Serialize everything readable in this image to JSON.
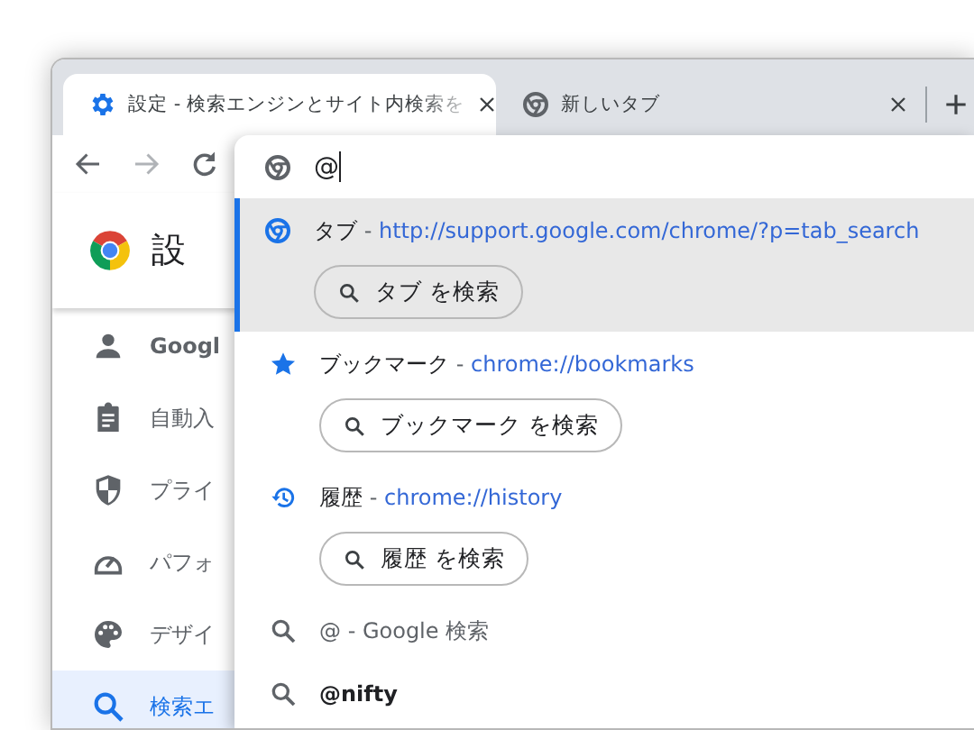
{
  "tabs": [
    {
      "title": "設定 - 検索エンジンとサイト内検索を",
      "kind": "settings",
      "selected": true
    },
    {
      "title": "新しいタブ",
      "kind": "newtab",
      "selected": false
    }
  ],
  "omnibox": {
    "value": "@"
  },
  "settings": {
    "title": "設",
    "sidebar": {
      "items": [
        {
          "label": "Googl",
          "kind": "person",
          "selected": false
        },
        {
          "label": "自動入",
          "kind": "clipboard",
          "selected": false
        },
        {
          "label": "プライ",
          "kind": "shield",
          "selected": false
        },
        {
          "label": "パフォ",
          "kind": "gauge",
          "selected": false
        },
        {
          "label": "デザイ",
          "kind": "palette",
          "selected": false
        },
        {
          "label": "検索エ",
          "kind": "search",
          "selected": true
        }
      ]
    }
  },
  "suggestions": [
    {
      "kind": "tabs",
      "title": "タブ",
      "separator": "-",
      "url": "http://support.google.com/chrome/?p=tab_search",
      "action": "タブ を検索",
      "selected": true
    },
    {
      "kind": "bookmarks",
      "title": "ブックマーク",
      "separator": "-",
      "url": "chrome://bookmarks",
      "action": "ブックマーク を検索",
      "selected": false
    },
    {
      "kind": "history",
      "title": "履歴",
      "separator": "-",
      "url": "chrome://history",
      "action": "履歴 を検索",
      "selected": false
    },
    {
      "kind": "search",
      "title": "@",
      "suffix": "- Google 検索",
      "selected": false
    },
    {
      "kind": "engine",
      "title": "@nifty",
      "selected": false
    }
  ]
}
